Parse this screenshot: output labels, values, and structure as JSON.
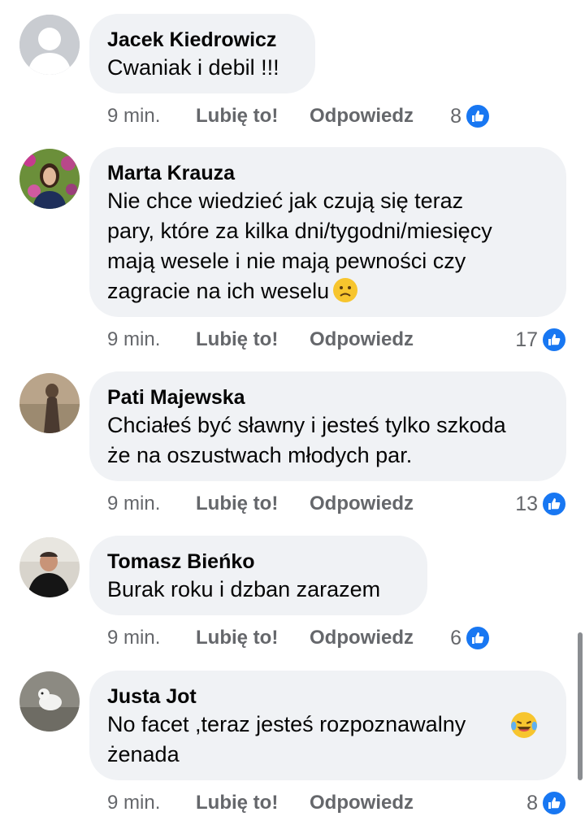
{
  "comments": [
    {
      "author": "Jacek Kiedrowicz",
      "text": "Cwaniak i debil !!!",
      "emoji": "",
      "time": "9 min.",
      "like_label": "Lubię to!",
      "reply_label": "Odpowiedz",
      "reactions": "8",
      "avatar": "default-avatar-icon"
    },
    {
      "author": "Marta Krauza",
      "text": "Nie chce wiedzieć jak czują się teraz\npary, które za kilka dni/tygodni/miesięcy\nmają wesele i nie mają pewności czy\nzagracie na ich weselu",
      "emoji": "sad-face-emoji",
      "time": "9 min.",
      "like_label": "Lubię to!",
      "reply_label": "Odpowiedz",
      "reactions": "17",
      "avatar": "profile-photo"
    },
    {
      "author": "Pati Majewska",
      "text": "Chciałeś być sławny i jesteś tylko szkoda\nże na oszustwach młodych par.",
      "emoji": "",
      "time": "9 min.",
      "like_label": "Lubię to!",
      "reply_label": "Odpowiedz",
      "reactions": "13",
      "avatar": "profile-photo"
    },
    {
      "author": "Tomasz Bieńko",
      "text": "Burak roku i dzban zarazem",
      "emoji": "",
      "time": "9 min.",
      "like_label": "Lubię to!",
      "reply_label": "Odpowiedz",
      "reactions": "6",
      "avatar": "profile-photo"
    },
    {
      "author": "Justa Jot",
      "text": "No facet ,teraz jesteś rozpoznawalny\nżenada",
      "emoji": "laughing-tears-emoji",
      "time": "9 min.",
      "like_label": "Lubię to!",
      "reply_label": "Odpowiedz",
      "reactions": "8",
      "avatar": "profile-photo"
    }
  ],
  "colors": {
    "bubble": "#f0f2f5",
    "meta_text": "#65676b",
    "like_blue": "#1877f2"
  }
}
